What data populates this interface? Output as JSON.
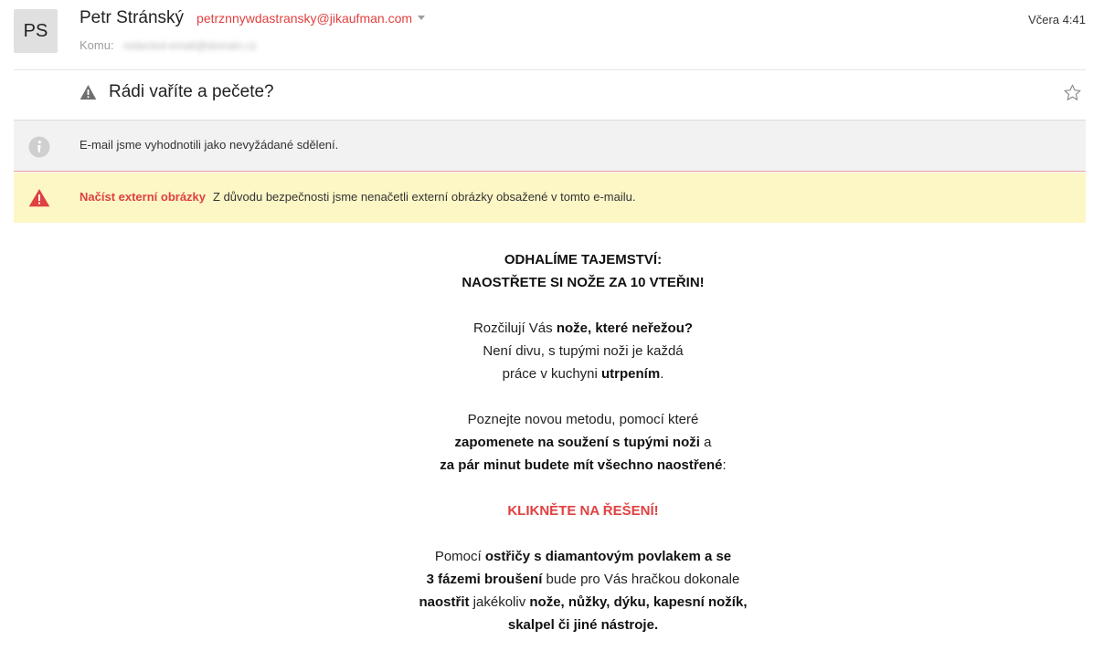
{
  "sender": {
    "initials": "PS",
    "name": "Petr Stránský",
    "email": "petrznnywdastransky@jikaufman.com"
  },
  "recipient": {
    "label": "Komu:",
    "value": "redacted-email@domain.cz"
  },
  "timestamp": "Včera 4:41",
  "subject": "Rádi vaříte a pečete?",
  "spam_notice": "E-mail jsme vyhodnotili jako nevyžádané sdělení.",
  "external_images": {
    "link_label": "Načíst externí obrázky",
    "message": "Z důvodu bezpečnosti jsme nenačetli externí obrázky obsažené v tomto e-mailu."
  },
  "body": {
    "h1": "ODHALÍME TAJEMSTVÍ:",
    "h2": "NAOSTŘETE SI NOŽE ZA 10 VTEŘIN!",
    "p1_a": "Rozčilují Vás ",
    "p1_b": "nože, které neřežou?",
    "p1_c": "Není divu, s tupými noži je každá",
    "p1_d": "práce v kuchyni ",
    "p1_e": "utrpením",
    "p1_f": ".",
    "p2_a": "Poznejte novou metodu, pomocí které",
    "p2_b": "zapomenete na soužení s tupými noži",
    "p2_c": " a",
    "p2_d": "za pár minut budete mít všechno naostřené",
    "p2_e": ":",
    "cta": "KLIKNĚTE NA ŘEŠENÍ!",
    "p3_a": "Pomocí ",
    "p3_b": "ostřičy s diamantovým povlakem a se",
    "p3_c": "3 fázemi broušení",
    "p3_d": " bude pro Vás hračkou dokonale",
    "p3_e": "naostřit",
    "p3_f": " jakékoliv ",
    "p3_g": "nože, nůžky, dýku, kapesní nožík,",
    "p3_h": "skalpel či jiné nástroje."
  },
  "colors": {
    "accent_red": "#e04040",
    "spam_bar_bg": "#f2f2f2",
    "external_bar_bg": "#fdf7c6",
    "avatar_bg": "#e0e0e0"
  },
  "icons": {
    "subject_warning": "warning-triangle-icon",
    "star": "star-outline-icon",
    "spam_info": "info-circle-icon",
    "external_warning": "warning-triangle-red-icon",
    "sender_dropdown": "chevron-down-icon"
  }
}
